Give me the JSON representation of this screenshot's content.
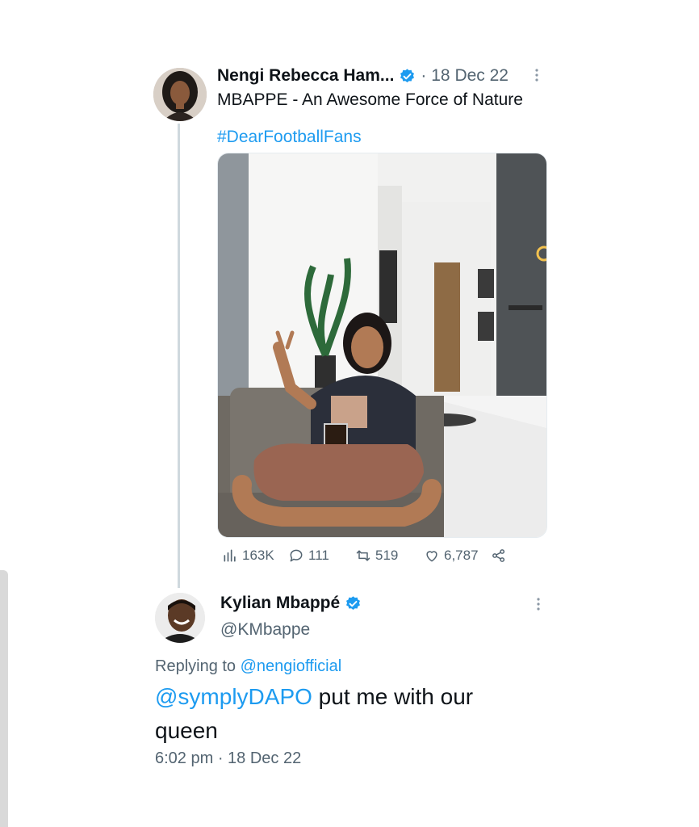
{
  "original_tweet": {
    "author_name": "Nengi Rebecca Ham...",
    "date": "· 18 Dec 22",
    "text": "MBAPPE - An Awesome Force of Nature",
    "hashtag": "#DearFootballFans",
    "stats": {
      "views": "163K",
      "replies": "111",
      "retweets": "519",
      "likes": "6,787"
    }
  },
  "reply_tweet": {
    "author_name": "Kylian Mbappé",
    "handle": "@KMbappe",
    "replying_prefix": "Replying to",
    "replying_handle": "@nengiofficial",
    "mention": "@symplyDAPO",
    "text_rest": " put me with our",
    "text_line2": "queen",
    "timestamp": "6:02 pm · 18 Dec 22"
  },
  "colors": {
    "accent": "#1d9bf0",
    "muted": "#536471",
    "text": "#0f1419"
  },
  "icons": [
    "verified-badge-icon",
    "more-options-icon",
    "views-icon",
    "reply-icon",
    "retweet-icon",
    "like-icon",
    "share-icon"
  ]
}
